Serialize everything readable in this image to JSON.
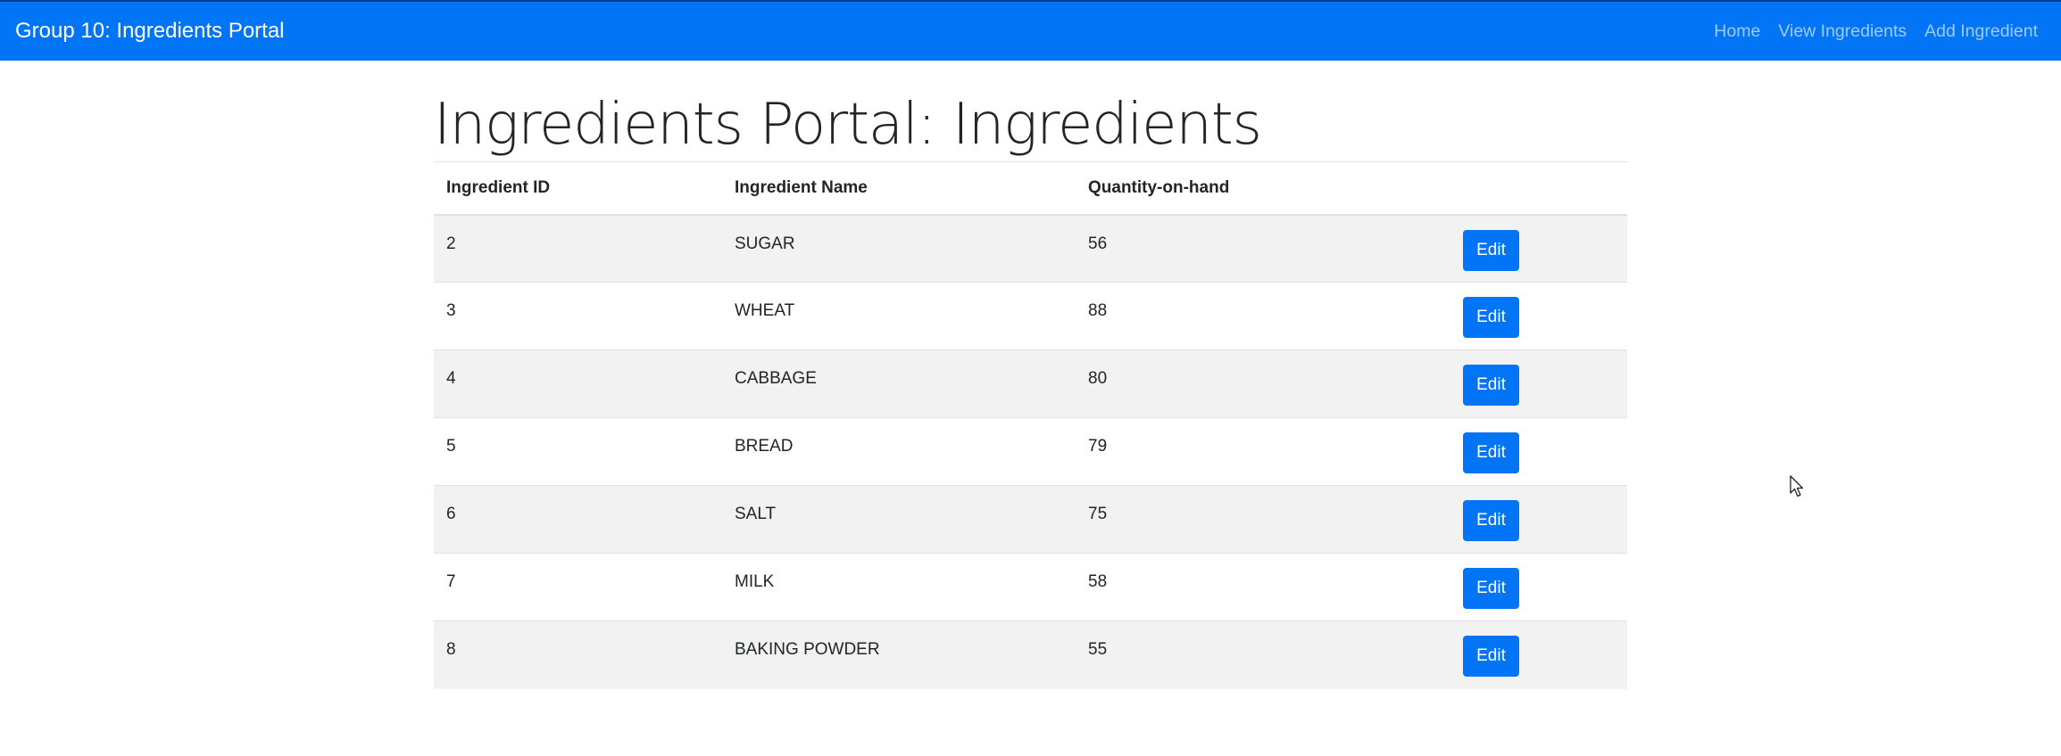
{
  "navbar": {
    "brand": "Group 10: Ingredients Portal",
    "links": [
      {
        "label": "Home"
      },
      {
        "label": "View Ingredients"
      },
      {
        "label": "Add Ingredient"
      }
    ]
  },
  "page": {
    "title": "Ingredients Portal: Ingredients"
  },
  "table": {
    "headers": [
      "Ingredient ID",
      "Ingredient Name",
      "Quantity-on-hand",
      ""
    ],
    "edit_label": "Edit",
    "rows": [
      {
        "id": "2",
        "name": "SUGAR",
        "qty": "56"
      },
      {
        "id": "3",
        "name": "WHEAT",
        "qty": "88"
      },
      {
        "id": "4",
        "name": "CABBAGE",
        "qty": "80"
      },
      {
        "id": "5",
        "name": "BREAD",
        "qty": "79"
      },
      {
        "id": "6",
        "name": "SALT",
        "qty": "75"
      },
      {
        "id": "7",
        "name": "MILK",
        "qty": "58"
      },
      {
        "id": "8",
        "name": "BAKING POWDER",
        "qty": "55"
      }
    ]
  },
  "colors": {
    "primary": "#0275f7",
    "stripe": "#f2f2f2",
    "text": "#212529"
  },
  "icons": {
    "cursor": "mouse-pointer-icon"
  }
}
